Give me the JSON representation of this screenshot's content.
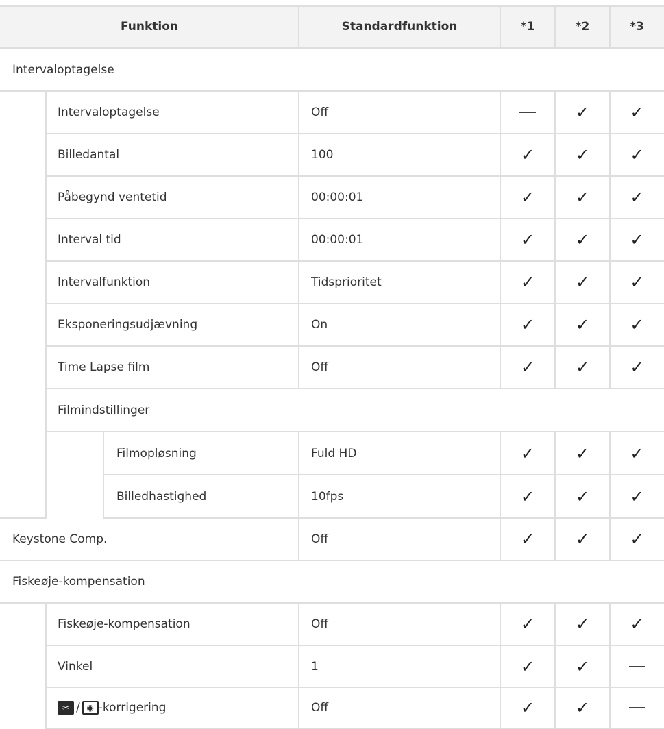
{
  "header": {
    "function": "Funktion",
    "default": "Standardfunktion",
    "col1": "*1",
    "col2": "*2",
    "col3": "*3"
  },
  "marks": {
    "check": "✓"
  },
  "sections": {
    "interval": {
      "title": "Intervaloptagelse",
      "rows": [
        {
          "label": "Intervaloptagelse",
          "default": "Off",
          "m1": "dash",
          "m2": "check",
          "m3": "check"
        },
        {
          "label": "Billedantal",
          "default": "100",
          "m1": "check",
          "m2": "check",
          "m3": "check"
        },
        {
          "label": "Påbegynd ventetid",
          "default": "00:00:01",
          "m1": "check",
          "m2": "check",
          "m3": "check"
        },
        {
          "label": "Interval tid",
          "default": "00:00:01",
          "m1": "check",
          "m2": "check",
          "m3": "check"
        },
        {
          "label": "Intervalfunktion",
          "default": "Tidsprioritet",
          "m1": "check",
          "m2": "check",
          "m3": "check"
        },
        {
          "label": "Eksponeringsudjævning",
          "default": "On",
          "m1": "check",
          "m2": "check",
          "m3": "check"
        },
        {
          "label": "Time Lapse film",
          "default": "Off",
          "m1": "check",
          "m2": "check",
          "m3": "check"
        }
      ],
      "film": {
        "title": "Filmindstillinger",
        "rows": [
          {
            "label": "Filmopløsning",
            "default": "Fuld HD",
            "m1": "check",
            "m2": "check",
            "m3": "check"
          },
          {
            "label": "Billedhastighed",
            "default": "10fps",
            "m1": "check",
            "m2": "check",
            "m3": "check"
          }
        ]
      }
    },
    "keystone": {
      "label": "Keystone Comp.",
      "default": "Off",
      "m1": "check",
      "m2": "check",
      "m3": "check"
    },
    "fisheye": {
      "title": "Fiskeøje-kompensation",
      "rows": [
        {
          "label": "Fiskeøje-kompensation",
          "default": "Off",
          "m1": "check",
          "m2": "check",
          "m3": "check"
        },
        {
          "label": "Vinkel",
          "default": "1",
          "m1": "check",
          "m2": "check",
          "m3": "dash"
        },
        {
          "label": "-korrigering",
          "default": "Off",
          "m1": "check",
          "m2": "check",
          "m3": "dash",
          "icons": [
            "fisheye-mode-icon",
            "fisheye-correction-icon"
          ]
        }
      ]
    }
  }
}
